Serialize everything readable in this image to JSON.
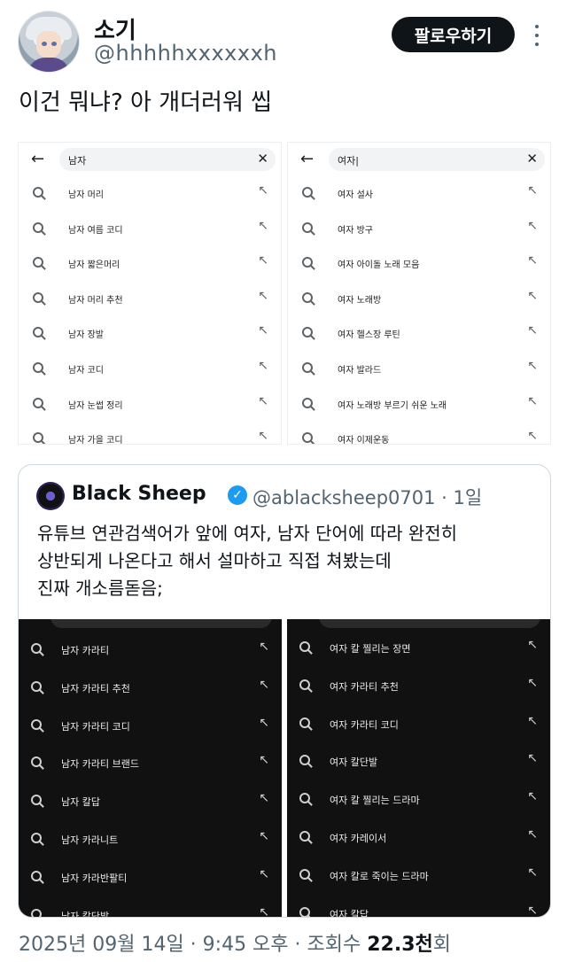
{
  "author": {
    "name": "소기",
    "handle": "@hhhhhxxxxxxh",
    "follow_label": "팔로우하기"
  },
  "tweet_text": "이건 뭐냐? 아 개더러워 씹",
  "left_panel": {
    "query": "남자",
    "suggestions": [
      "남자 머리",
      "남자 여름 코디",
      "남자 짧은머리",
      "남자 머리 추천",
      "남자 장발",
      "남자 코디",
      "남자 눈썹 정리",
      "남자 가을 코디"
    ]
  },
  "right_panel": {
    "query": "여자|",
    "suggestions": [
      "여자 설사",
      "여자 방구",
      "여자 아이돌 노래 모음",
      "여자 노래방",
      "여자 헬스장 루틴",
      "여자 발라드",
      "여자 노래방 부르기 쉬운 노래",
      "여자 이제운동"
    ]
  },
  "quote": {
    "name": "Black Sheep",
    "meta": "@ablacksheep0701 · 1일",
    "lines": [
      "유튜브 연관검색어가 앞에 여자, 남자 단어에 따라 완전히",
      "상반되게 나온다고 해서 설마하고 직접 쳐봤는데",
      "진짜 개소름돋음;"
    ],
    "dark_left": [
      "남자 카라티",
      "남자 카라티 추천",
      "남자 카라티 코디",
      "남자 카라티 브랜드",
      "남자 칼답",
      "남자 카라니트",
      "남자 카라반팔티",
      "남자 칼단발"
    ],
    "dark_right": [
      "여자 칼 찔리는 장면",
      "여자 카라티 추천",
      "여자 카라티 코디",
      "여자 칼단발",
      "여자 칼 찔리는 드라마",
      "여자 카레이서",
      "여자 칼로 죽이는 드라마",
      "여자 칼답"
    ]
  },
  "footer": {
    "date": "2025년 09월 14일 · 9:45 오후 · 조회수 ",
    "views": "22.3천",
    "views_suffix": "회"
  },
  "colors": {
    "follow_bg": "#0f1419",
    "verified": "#1d9bf0",
    "secondary_text": "#536471",
    "dark_panel": "#111111"
  },
  "icons": [
    "more-vertical-icon",
    "back-arrow-icon",
    "clear-x-icon",
    "search-icon",
    "insert-arrow-icon",
    "verified-badge-icon"
  ]
}
